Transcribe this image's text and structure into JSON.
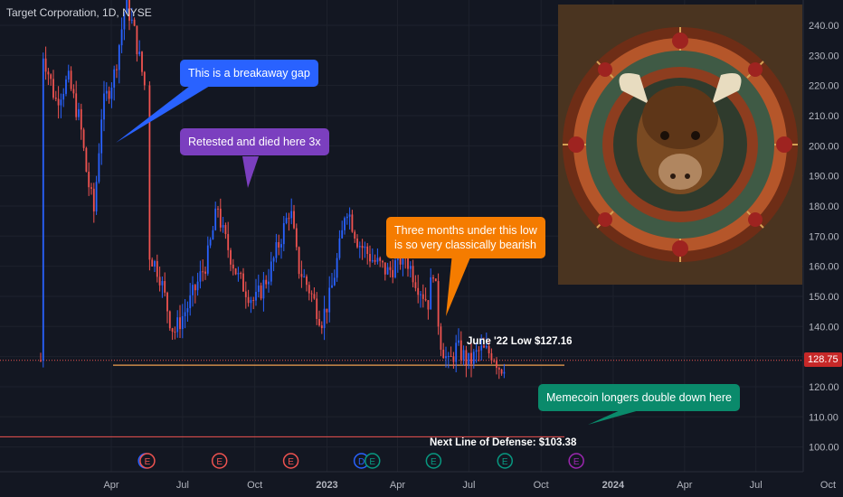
{
  "header": {
    "symbol": "Target Corporation, 1D, NYSE"
  },
  "price_tag": "128.75",
  "annotations": {
    "breakaway_gap": "This is a breakaway gap",
    "retested": "Retested and died here 3x",
    "three_months": "Three months under this low\nis so very classically bearish",
    "memecoin": "Memecoin longers double down here"
  },
  "levels": {
    "june_low_label": "June '22 Low $127.16",
    "defense_label": "Next Line of Defense: $103.38"
  },
  "colors": {
    "background": "#131722",
    "grid": "#1e222d",
    "up": "#2962ff",
    "down": "#ef5350",
    "june_low_line": "#f0a050",
    "defense_line": "#ef5350",
    "callout_blue": "#2962ff",
    "callout_purple": "#7b3fbf",
    "callout_orange": "#f57c00",
    "callout_teal": "#0a8a6b"
  },
  "chart_data": {
    "type": "candlestick",
    "title": "Target Corporation, 1D, NYSE",
    "ylim": [
      95,
      248
    ],
    "y_ticks": [
      "100.00",
      "110.00",
      "120.00",
      "130.00",
      "140.00",
      "150.00",
      "160.00",
      "170.00",
      "180.00",
      "190.00",
      "200.00",
      "210.00",
      "220.00",
      "230.00",
      "240.00"
    ],
    "x_ticks": [
      "Apr",
      "Jul",
      "Oct",
      "2023",
      "Apr",
      "Jul",
      "Oct",
      "2024",
      "Apr",
      "Jul",
      "Oct"
    ],
    "levels": [
      {
        "label": "June '22 Low $127.16",
        "value": 127.16
      },
      {
        "label": "Next Line of Defense: $103.38",
        "value": 103.38
      },
      {
        "label": "128.75",
        "value": 128.75
      }
    ],
    "price_path": [
      [
        "2022-01-03",
        232
      ],
      [
        "2022-01-20",
        215
      ],
      [
        "2022-02-05",
        222
      ],
      [
        "2022-02-20",
        208
      ],
      [
        "2022-03-01",
        190
      ],
      [
        "2022-03-10",
        178
      ],
      [
        "2022-03-20",
        212
      ],
      [
        "2022-04-05",
        224
      ],
      [
        "2022-04-20",
        248
      ],
      [
        "2022-05-01",
        237
      ],
      [
        "2022-05-15",
        218
      ],
      [
        "2022-05-18",
        165
      ],
      [
        "2022-06-01",
        158
      ],
      [
        "2022-06-15",
        142
      ],
      [
        "2022-06-20",
        138
      ],
      [
        "2022-07-10",
        148
      ],
      [
        "2022-08-01",
        162
      ],
      [
        "2022-08-15",
        180
      ],
      [
        "2022-08-20",
        172
      ],
      [
        "2022-09-10",
        156
      ],
      [
        "2022-10-01",
        148
      ],
      [
        "2022-10-20",
        158
      ],
      [
        "2022-11-10",
        175
      ],
      [
        "2022-11-15",
        180
      ],
      [
        "2022-11-25",
        160
      ],
      [
        "2022-12-10",
        152
      ],
      [
        "2022-12-25",
        142
      ],
      [
        "2023-01-05",
        150
      ],
      [
        "2023-01-20",
        170
      ],
      [
        "2023-01-25",
        181
      ],
      [
        "2023-02-10",
        168
      ],
      [
        "2023-03-01",
        162
      ],
      [
        "2023-03-20",
        158
      ],
      [
        "2023-04-10",
        164
      ],
      [
        "2023-04-25",
        155
      ],
      [
        "2023-05-10",
        148
      ],
      [
        "2023-05-17",
        160
      ],
      [
        "2023-05-25",
        136
      ],
      [
        "2023-06-05",
        127
      ],
      [
        "2023-06-15",
        133
      ],
      [
        "2023-07-01",
        128
      ],
      [
        "2023-07-15",
        132
      ],
      [
        "2023-08-01",
        131
      ],
      [
        "2023-08-10",
        126
      ],
      [
        "2023-08-18",
        128.75
      ]
    ],
    "events": [
      {
        "kind": "dividend",
        "label": "D",
        "date": "2022-05-15"
      },
      {
        "kind": "earnings",
        "label": "E",
        "date": "2022-05-17"
      },
      {
        "kind": "earnings",
        "label": "E",
        "date": "2022-08-17"
      },
      {
        "kind": "earnings",
        "label": "E",
        "date": "2022-11-16"
      },
      {
        "kind": "dividend",
        "label": "D",
        "date": "2023-02-14"
      },
      {
        "kind": "earnings",
        "label": "E",
        "date": "2023-02-28"
      },
      {
        "kind": "earnings",
        "label": "E",
        "date": "2023-05-17"
      },
      {
        "kind": "earnings",
        "label": "E",
        "date": "2023-08-16"
      },
      {
        "kind": "earnings-upcoming",
        "label": "E",
        "date": "2023-11-15"
      }
    ]
  }
}
